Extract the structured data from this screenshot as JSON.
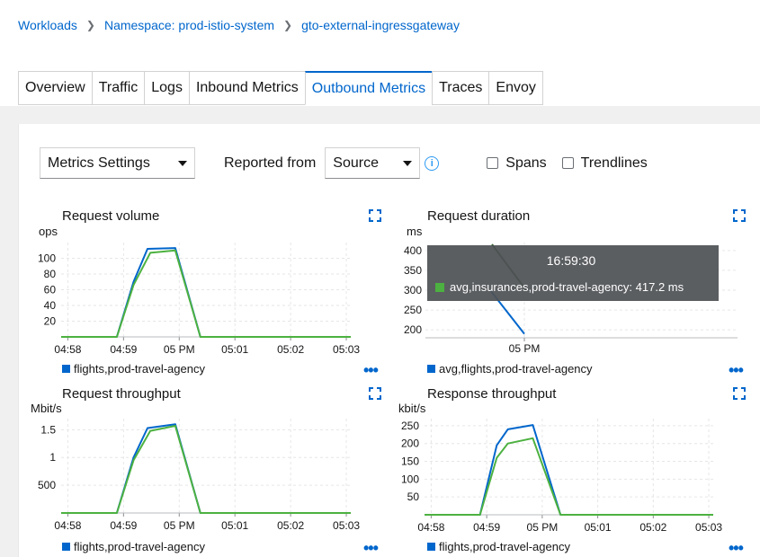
{
  "breadcrumb": {
    "items": [
      "Workloads",
      "Namespace: prod-istio-system",
      "gto-external-ingressgateway"
    ]
  },
  "tabs": [
    {
      "label": "Overview",
      "active": false
    },
    {
      "label": "Traffic",
      "active": false
    },
    {
      "label": "Logs",
      "active": false
    },
    {
      "label": "Inbound Metrics",
      "active": false
    },
    {
      "label": "Outbound Metrics",
      "active": true
    },
    {
      "label": "Traces",
      "active": false
    },
    {
      "label": "Envoy",
      "active": false
    }
  ],
  "toolbar": {
    "metrics_settings_label": "Metrics Settings",
    "reported_from_label": "Reported from",
    "reported_from_value": "Source",
    "spans_label": "Spans",
    "trendlines_label": "Trendlines"
  },
  "colors": {
    "series_blue": "#0066cc",
    "series_green": "#4cb140",
    "link": "#0066cc"
  },
  "x_ticks": [
    "04:58",
    "04:59",
    "05 PM",
    "05:01",
    "05:02",
    "05:03"
  ],
  "charts": [
    {
      "title": "Request volume",
      "unit": "ops",
      "legend": "flights,prod-travel-agency",
      "y_ticks": [
        "100",
        "80",
        "60",
        "40",
        "20"
      ]
    },
    {
      "title": "Request duration",
      "unit": "ms",
      "legend": "avg,flights,prod-travel-agency",
      "y_ticks": [
        "400",
        "350",
        "300",
        "250",
        "200"
      ],
      "x_tick": "05 PM",
      "tooltip": {
        "time": "16:59:30",
        "entry": "avg,insurances,prod-travel-agency: 417.2 ms"
      }
    },
    {
      "title": "Request throughput",
      "unit": "Mbit/s",
      "legend": "flights,prod-travel-agency",
      "y_ticks": [
        "1.5",
        "1",
        "500"
      ]
    },
    {
      "title": "Response throughput",
      "unit": "kbit/s",
      "legend": "flights,prod-travel-agency",
      "y_ticks": [
        "250",
        "200",
        "150",
        "100",
        "50"
      ]
    }
  ],
  "chart_data": [
    {
      "type": "line",
      "title": "Request volume",
      "ylabel": "ops",
      "x": [
        "04:58",
        "04:59",
        "05 PM",
        "05:01",
        "05:02",
        "05:03"
      ],
      "ylim": [
        0,
        120
      ],
      "series": [
        {
          "name": "flights,prod-travel-agency",
          "color": "#0066cc",
          "points": [
            [
              0,
              0
            ],
            [
              1,
              0
            ],
            [
              1.3,
              70
            ],
            [
              1.55,
              112
            ],
            [
              2.05,
              113
            ],
            [
              2.5,
              0
            ],
            [
              5.2,
              0
            ]
          ]
        },
        {
          "color": "#4cb140",
          "points": [
            [
              0,
              0
            ],
            [
              1,
              0
            ],
            [
              1.3,
              66
            ],
            [
              1.6,
              107
            ],
            [
              2.05,
              110
            ],
            [
              2.5,
              0
            ],
            [
              5.2,
              0
            ]
          ]
        }
      ]
    },
    {
      "type": "line",
      "title": "Request duration",
      "ylabel": "ms",
      "ylim": [
        180,
        420
      ],
      "series": [
        {
          "name": "avg,flights,prod-travel-agency",
          "color": "#0066cc"
        },
        {
          "name": "avg,insurances,prod-travel-agency",
          "color": "#4cb140"
        }
      ]
    },
    {
      "type": "line",
      "title": "Request throughput",
      "ylabel": "Mbit/s",
      "x": [
        "04:58",
        "04:59",
        "05 PM",
        "05:01",
        "05:02",
        "05:03"
      ],
      "ylim": [
        0,
        1.7
      ],
      "series": [
        {
          "name": "flights,prod-travel-agency",
          "color": "#0066cc",
          "points": [
            [
              0,
              0
            ],
            [
              1,
              0
            ],
            [
              1.3,
              1.0
            ],
            [
              1.55,
              1.53
            ],
            [
              2.05,
              1.6
            ],
            [
              2.5,
              0
            ],
            [
              5.2,
              0
            ]
          ]
        },
        {
          "color": "#4cb140",
          "points": [
            [
              0,
              0
            ],
            [
              1,
              0
            ],
            [
              1.3,
              0.95
            ],
            [
              1.6,
              1.48
            ],
            [
              2.05,
              1.57
            ],
            [
              2.5,
              0
            ],
            [
              5.2,
              0
            ]
          ]
        }
      ]
    },
    {
      "type": "line",
      "title": "Response throughput",
      "ylabel": "kbit/s",
      "x": [
        "04:58",
        "04:59",
        "05 PM",
        "05:01",
        "05:02",
        "05:03"
      ],
      "ylim": [
        0,
        270
      ],
      "series": [
        {
          "name": "flights,prod-travel-agency",
          "color": "#0066cc",
          "points": [
            [
              0,
              0
            ],
            [
              1,
              0
            ],
            [
              1.3,
              195
            ],
            [
              1.5,
              240
            ],
            [
              1.95,
              252
            ],
            [
              2.45,
              0
            ],
            [
              5.2,
              0
            ]
          ]
        },
        {
          "color": "#4cb140",
          "points": [
            [
              0,
              0
            ],
            [
              1,
              0
            ],
            [
              1.3,
              160
            ],
            [
              1.5,
              200
            ],
            [
              1.95,
              215
            ],
            [
              2.45,
              0
            ],
            [
              5.2,
              0
            ]
          ]
        }
      ]
    }
  ]
}
